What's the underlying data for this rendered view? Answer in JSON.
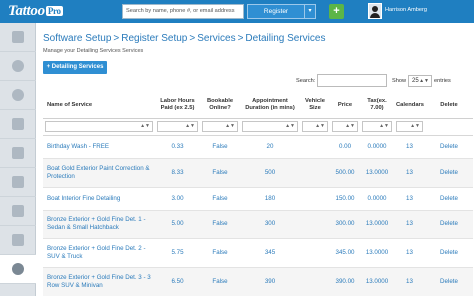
{
  "app": {
    "logo_text": "Tattoo",
    "logo_badge": "Pro"
  },
  "header": {
    "search_placeholder": "Search by name, phone #, or email address",
    "register_label": "Register",
    "register_caret": "▾",
    "add_label": "+",
    "user_name": "Harrison Amberg"
  },
  "sidebar": {
    "items": [
      {
        "icon": "tools-icon"
      },
      {
        "icon": "globe-icon"
      },
      {
        "icon": "chat-icon"
      },
      {
        "icon": "calendar-icon"
      },
      {
        "icon": "tag-icon"
      },
      {
        "icon": "person-icon"
      },
      {
        "icon": "id-card-icon"
      },
      {
        "icon": "bank-icon"
      },
      {
        "icon": "gear-icon",
        "active": true
      }
    ]
  },
  "breadcrumb": {
    "items": [
      "Software Setup",
      "Register Setup",
      "Services",
      "Detailing Services"
    ],
    "separator": ">"
  },
  "page": {
    "subtitle": "Manage your Detailing Services Services",
    "add_button": "+ Detailing Services"
  },
  "table_controls": {
    "search_label": "Search:",
    "show_label": "Show",
    "show_value": "25",
    "entries_label": "entries"
  },
  "table": {
    "headers": [
      "Name of Service",
      "Labor Hours Paid (ex 2.5)",
      "Bookable Online?",
      "Appointment Duration (in mins)",
      "Vehicle Size",
      "Price",
      "Tax(ex. 7.00)",
      "Calendars",
      "Delete"
    ],
    "rows": [
      [
        "Birthday Wash - FREE",
        "0.33",
        "False",
        "20",
        "",
        "0.00",
        "0.0000",
        "13",
        "Delete"
      ],
      [
        "Boat Gold Exterior Paint Correction & Protection",
        "8.33",
        "False",
        "500",
        "",
        "500.00",
        "13.0000",
        "13",
        "Delete"
      ],
      [
        "Boat Interior Fine Detailing",
        "3.00",
        "False",
        "180",
        "",
        "150.00",
        "0.0000",
        "13",
        "Delete"
      ],
      [
        "Bronze Exterior + Gold Fine Det. 1 - Sedan & Small Hatchback",
        "5.00",
        "False",
        "300",
        "",
        "300.00",
        "13.0000",
        "13",
        "Delete"
      ],
      [
        "Bronze Exterior + Gold Fine Det. 2 - SUV & Truck",
        "5.75",
        "False",
        "345",
        "",
        "345.00",
        "13.0000",
        "13",
        "Delete"
      ],
      [
        "Bronze Exterior + Gold Fine Det. 3 - 3 Row SUV & Minivan",
        "6.50",
        "False",
        "390",
        "",
        "390.00",
        "13.0000",
        "13",
        "Delete"
      ]
    ]
  },
  "colors": {
    "topbar": "#1f7fc1",
    "link": "#2b7bbb",
    "add_button": "#2f8fd3",
    "plus_button": "#5cb547"
  }
}
